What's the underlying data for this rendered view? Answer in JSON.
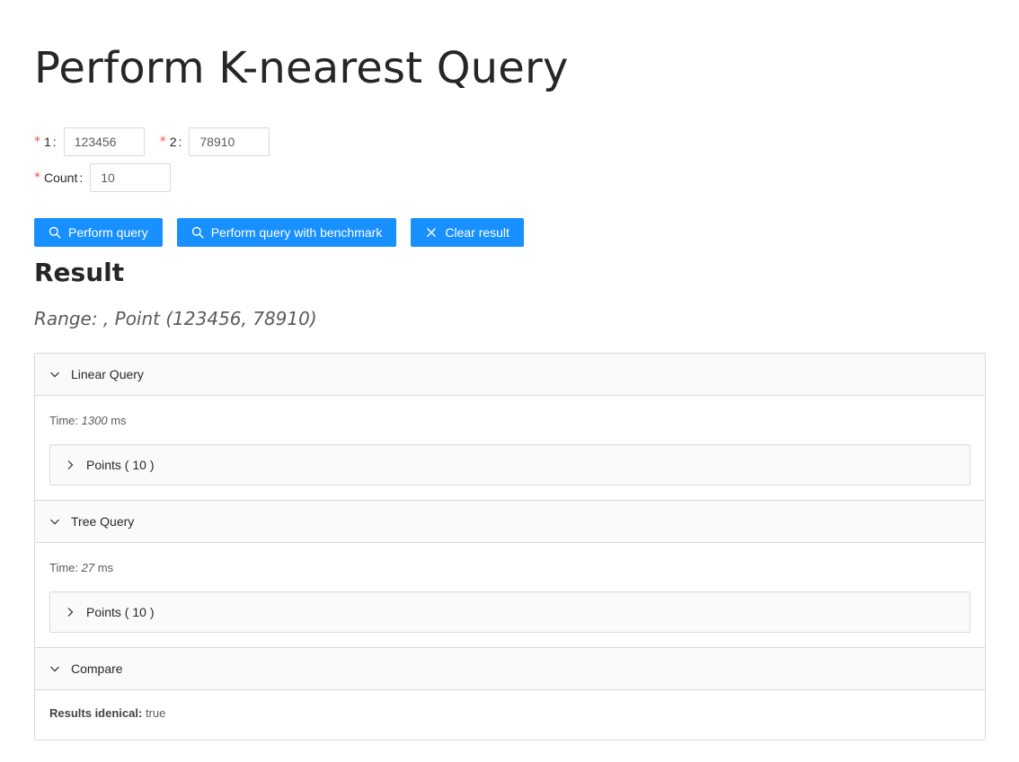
{
  "page": {
    "title": "Perform K-nearest Query"
  },
  "form": {
    "field1": {
      "label": "1",
      "value": "123456"
    },
    "field2": {
      "label": "2",
      "value": "78910"
    },
    "count": {
      "label": "Count",
      "value": "10"
    },
    "required_mark": "*",
    "colon": ":"
  },
  "buttons": {
    "perform_query": "Perform query",
    "perform_benchmark": "Perform query with benchmark",
    "clear_result": "Clear result"
  },
  "result": {
    "heading": "Result",
    "range_line": "Range: , Point (123456, 78910)",
    "panels": {
      "linear": {
        "title": "Linear Query",
        "time_label": "Time:",
        "time_value": "1300",
        "time_unit": "ms",
        "points_label": "Points ( 10 )"
      },
      "tree": {
        "title": "Tree Query",
        "time_label": "Time:",
        "time_value": "27",
        "time_unit": "ms",
        "points_label": "Points ( 10 )"
      },
      "compare": {
        "title": "Compare",
        "identical_label": "Results idenical:",
        "identical_value": "true"
      }
    }
  },
  "colors": {
    "primary": "#1890ff",
    "required": "#ff4d4f",
    "border": "#d9d9d9",
    "panel_bg": "#fafafa"
  },
  "icons": {
    "search": "search-icon",
    "close": "close-icon",
    "expanded": "chevron-down-icon",
    "collapsed": "chevron-right-icon"
  }
}
